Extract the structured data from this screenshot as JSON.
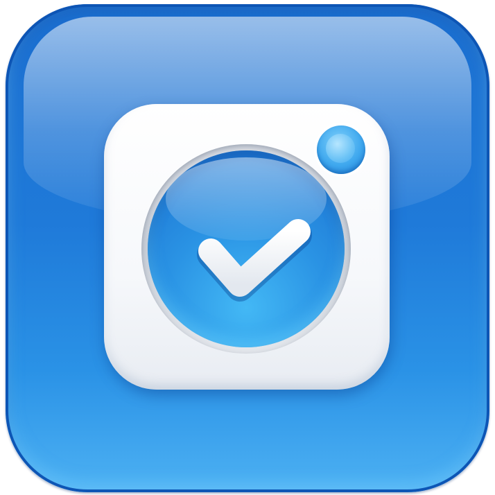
{
  "icon": {
    "name": "camera-check-app-icon",
    "glyphs": [
      "rounded-square-tile",
      "camera-frame",
      "lens-dot",
      "lens",
      "checkmark-icon"
    ],
    "colors": {
      "tile": "#1f7ad9",
      "tile_light": "#4db1f3",
      "frame": "#f4f6f9",
      "lens": "#2a93e4",
      "checkmark": "#ffffff"
    }
  }
}
